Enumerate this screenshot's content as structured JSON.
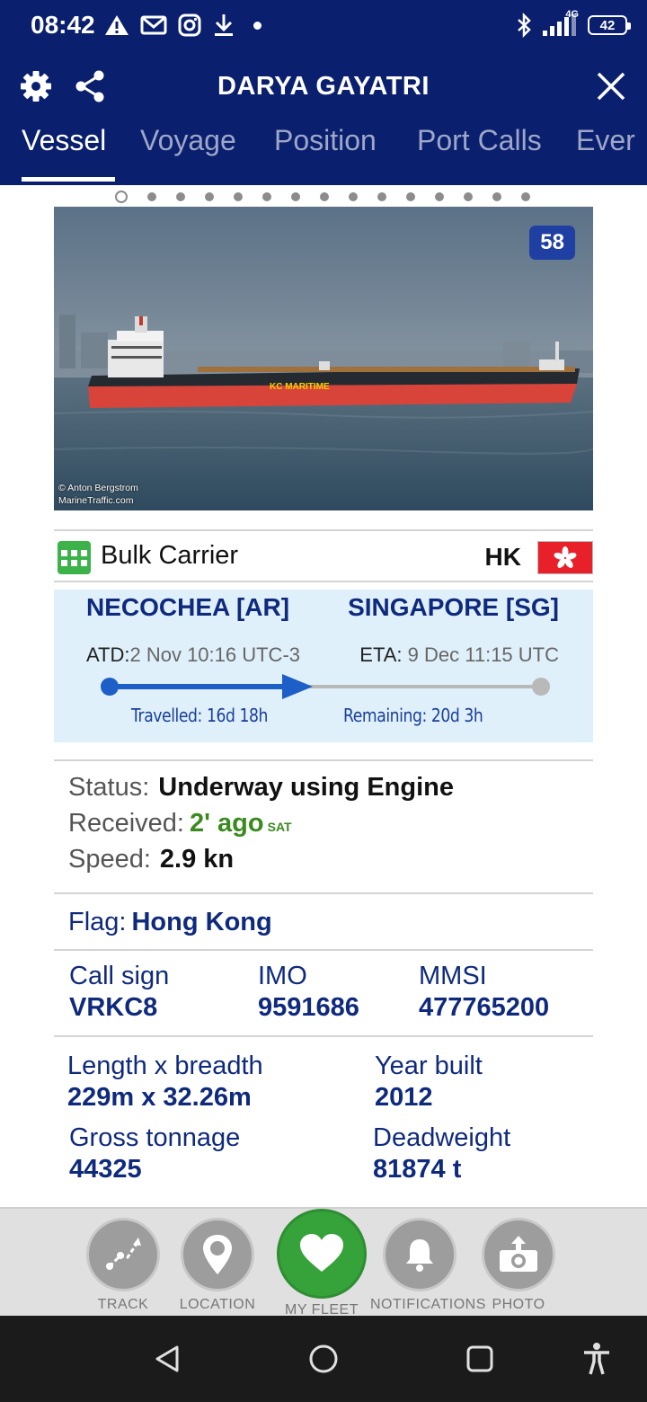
{
  "status_bar": {
    "time": "08:42",
    "network": "4G",
    "battery": "42",
    "icons_left": [
      "warning-icon",
      "gmail-icon",
      "instagram-icon",
      "download-icon",
      "dot-icon"
    ],
    "icons_right": [
      "bluetooth-icon",
      "signal-icon",
      "battery-icon"
    ]
  },
  "header": {
    "title": "DARYA GAYATRI",
    "tabs": [
      {
        "label": "Vessel",
        "active": true
      },
      {
        "label": "Voyage",
        "active": false
      },
      {
        "label": "Position",
        "active": false
      },
      {
        "label": "Port Calls",
        "active": false
      },
      {
        "label": "Ever",
        "active": false
      }
    ]
  },
  "photo": {
    "badge": "58",
    "credit_line1": "© Anton Bergstrom",
    "credit_line2": "MarineTraffic.com",
    "hull_text": "KC MARITIME",
    "page_count": 15,
    "current_page": 1
  },
  "vessel_type": {
    "label": "Bulk Carrier",
    "flag_code": "HK"
  },
  "route": {
    "origin": "NECOCHEA [AR]",
    "destination": "SINGAPORE [SG]",
    "atd_label": "ATD:",
    "atd_value": "2 Nov 10:16 UTC-3",
    "eta_label": "ETA:",
    "eta_value": "9 Dec 11:15 UTC",
    "travelled": "Travelled: 16d 18h",
    "remaining": "Remaining: 20d 3h",
    "progress_fraction": 0.45,
    "colors": {
      "progress": "#1e5ec7",
      "track": "#b9b9b9",
      "background": "#dff0fb"
    }
  },
  "status": {
    "status_label": "Status:",
    "status_value": "Underway using Engine",
    "received_label": "Received:",
    "received_value": "2' ago",
    "received_source": "SAT",
    "speed_label": "Speed:",
    "speed_value": "2.9 kn"
  },
  "flag": {
    "label": "Flag:",
    "value": "Hong Kong"
  },
  "identifiers": {
    "call_sign_label": "Call sign",
    "call_sign_value": "VRKC8",
    "imo_label": "IMO",
    "imo_value": "9591686",
    "mmsi_label": "MMSI",
    "mmsi_value": "477765200"
  },
  "dimensions": {
    "length_label": "Length x breadth",
    "length_value": "229m x 32.26m",
    "year_label": "Year built",
    "year_value": "2012",
    "gross_label": "Gross tonnage",
    "gross_value": "44325",
    "deadweight_label": "Deadweight",
    "deadweight_value": "81874 t"
  },
  "bottom_nav": [
    {
      "label": "TRACK",
      "icon": "track-icon"
    },
    {
      "label": "LOCATION",
      "icon": "location-pin-icon"
    },
    {
      "label": "MY FLEET",
      "icon": "heart-icon"
    },
    {
      "label": "NOTIFICATIONS",
      "icon": "bell-icon"
    },
    {
      "label": "PHOTO",
      "icon": "camera-upload-icon"
    }
  ],
  "theme": {
    "header_bg": "#0a1f6e",
    "accent_blue": "#0f2a7d",
    "fleet_green": "#35a23a",
    "received_green": "#3a8a20"
  }
}
